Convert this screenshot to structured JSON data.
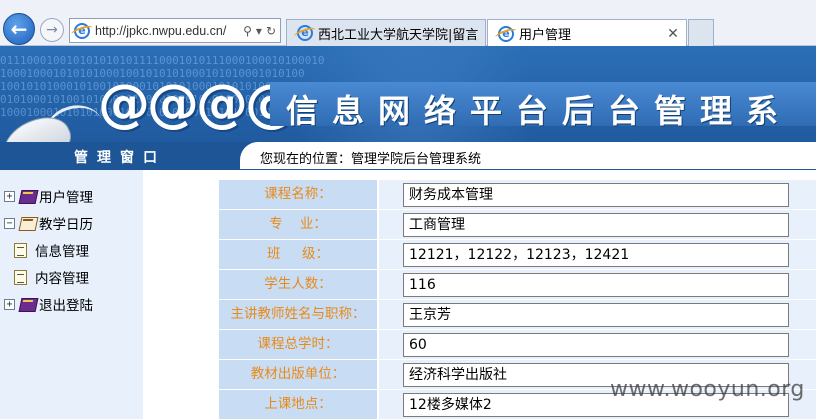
{
  "browser": {
    "address": "http://jpkc.nwpu.edu.cn/",
    "tabs": [
      {
        "label": "西北工业大学航天学院|留言版"
      },
      {
        "label": "用户管理"
      }
    ]
  },
  "banner": {
    "at_signs": "@@@@",
    "title": "信息网络平台后台管理系",
    "window_label": "管理窗口",
    "breadcrumb": "您现在的位置：管理学院后台管理系统"
  },
  "sidebar": {
    "items": [
      {
        "label": "用户管理",
        "expander": "+"
      },
      {
        "label": "教学日历",
        "expander": "−"
      },
      {
        "label": "信息管理"
      },
      {
        "label": "内容管理"
      },
      {
        "label": "退出登陆",
        "expander": "+"
      }
    ]
  },
  "form": {
    "rows": [
      {
        "label": "课程名称：",
        "value": "财务成本管理"
      },
      {
        "label": "专    业：",
        "value": "工商管理"
      },
      {
        "label": "班     级：",
        "value": "12121，12122，12123，12421"
      },
      {
        "label": "学生人数：",
        "value": "116"
      },
      {
        "label": "主讲教师姓名与职称：",
        "value": "王京芳"
      },
      {
        "label": "课程总学时：",
        "value": "60"
      },
      {
        "label": "教材出版单位：",
        "value": "经济科学出版社"
      },
      {
        "label": "上课地点：",
        "value": "12楼多媒体2"
      }
    ]
  },
  "watermark": "www.wooyun.org"
}
